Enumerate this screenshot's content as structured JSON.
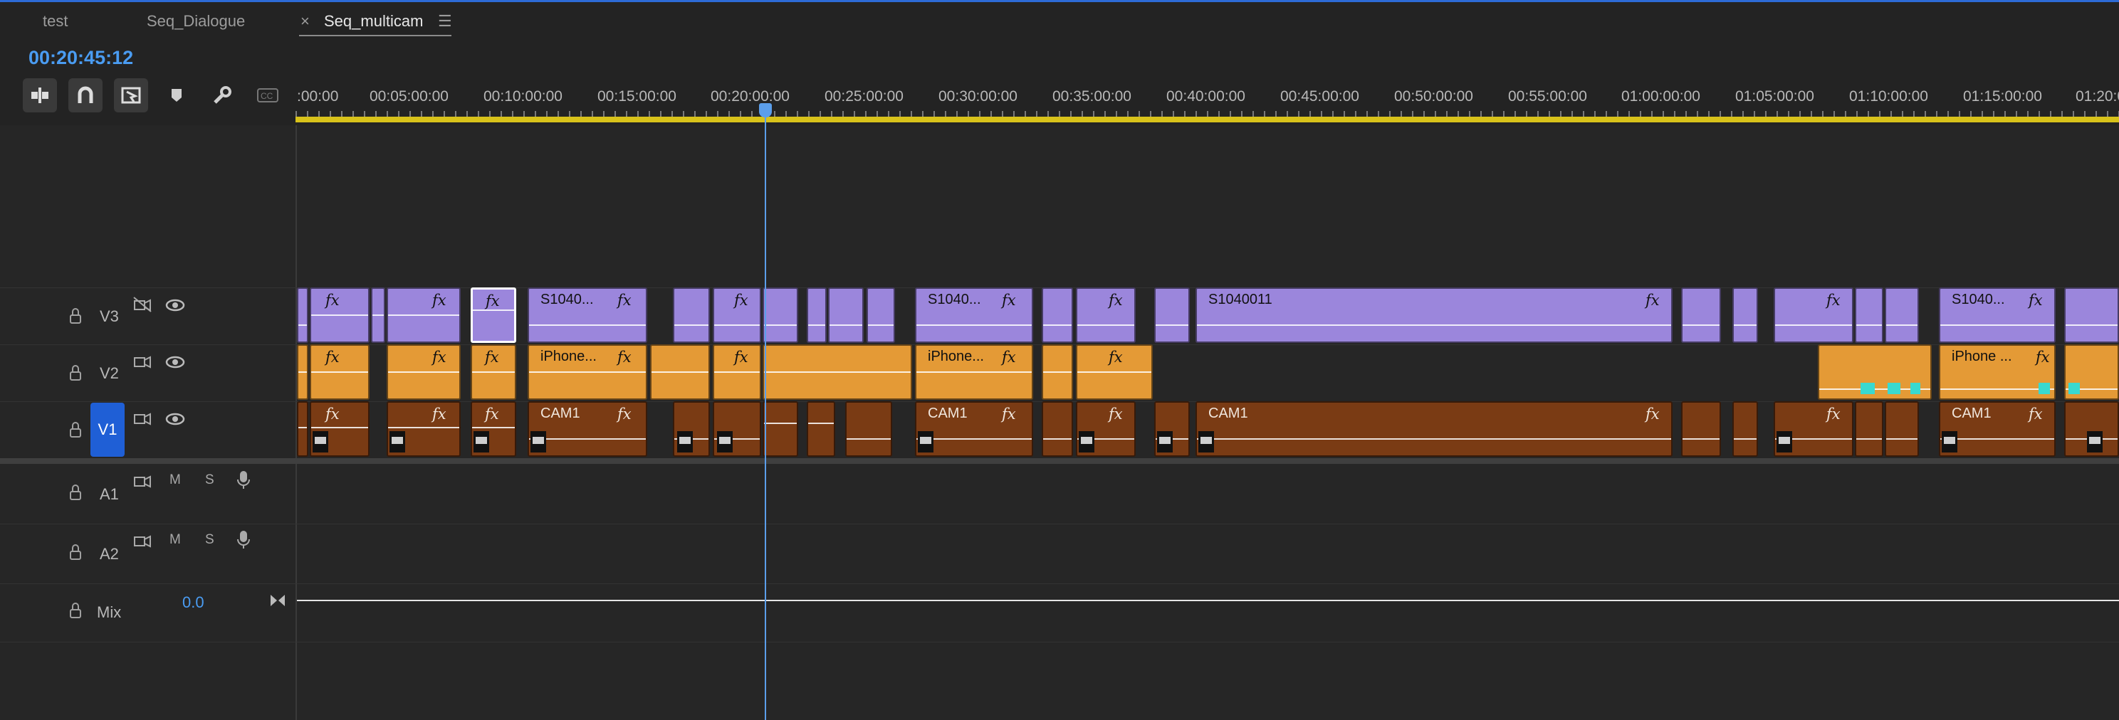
{
  "tabs": [
    {
      "label": "test"
    },
    {
      "label": "Seq_Dialogue"
    },
    {
      "label": "Seq_multicam",
      "close": "×",
      "menu": "☰"
    }
  ],
  "timecode": "00:20:45:12",
  "toolbar": {
    "icons": [
      "insert-overwrite-icon",
      "snap-magnet-icon",
      "linked-selection-icon",
      "add-marker-icon",
      "settings-wrench-icon",
      "captions-icon"
    ]
  },
  "ruler": {
    "labels": [
      ":00:00",
      "00:05:00:00",
      "00:10:00:00",
      "00:15:00:00",
      "00:20:00:00",
      "00:25:00:00",
      "00:30:00:00",
      "00:35:00:00",
      "00:40:00:00",
      "00:45:00:00",
      "00:50:00:00",
      "00:55:00:00",
      "01:00:00:00",
      "01:05:00:00",
      "01:10:00:00",
      "01:15:00:00",
      "01:20:0"
    ]
  },
  "tracks": {
    "v3": {
      "name": "V3"
    },
    "v2": {
      "name": "V2"
    },
    "v1": {
      "name": "V1"
    },
    "a1": {
      "name": "A1",
      "m": "M",
      "s": "S"
    },
    "a2": {
      "name": "A2",
      "m": "M",
      "s": "S"
    },
    "mix": {
      "name": "Mix",
      "value": "0.0"
    }
  },
  "clips": {
    "fx": "fx",
    "v3": [
      "S1040...",
      "S1040...",
      "S1040011",
      "S1040..."
    ],
    "v2": [
      "iPhone...",
      "iPhone...",
      "iPhone ..."
    ],
    "v1": [
      "CAM1",
      "CAM1",
      "CAM1",
      "CAM1"
    ]
  }
}
